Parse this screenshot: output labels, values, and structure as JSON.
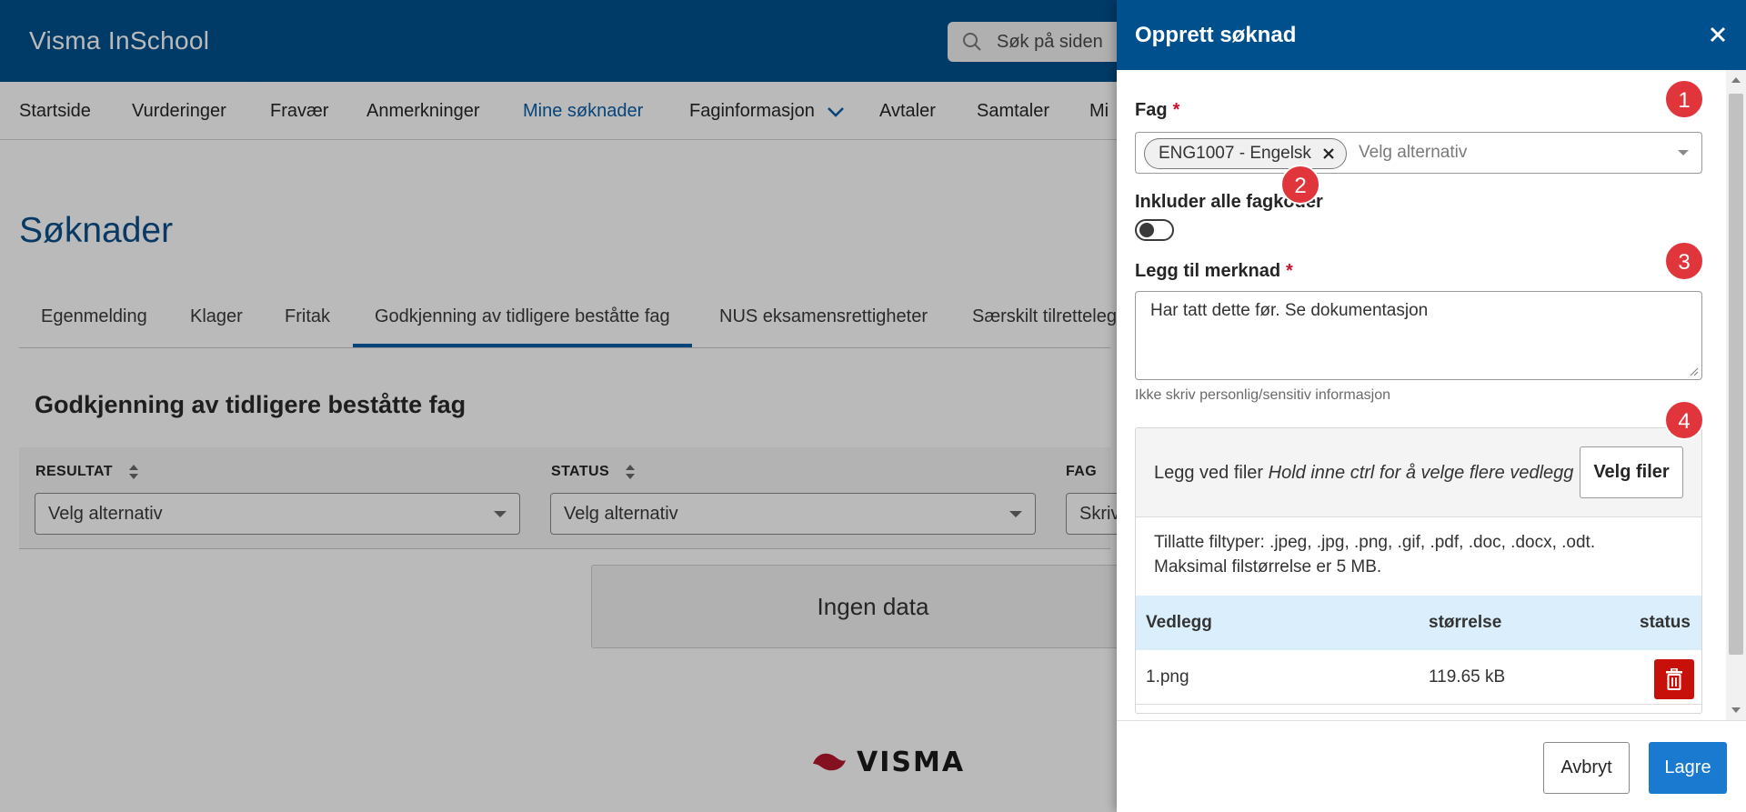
{
  "app": {
    "title": "Visma InSchool",
    "search_placeholder": "Søk på siden",
    "footer_logo_text": "VISMA"
  },
  "nav": {
    "items": [
      {
        "label": "Startside"
      },
      {
        "label": "Vurderinger"
      },
      {
        "label": "Fravær"
      },
      {
        "label": "Anmerkninger"
      },
      {
        "label": "Mine søknader",
        "active": true
      },
      {
        "label": "Faginformasjon",
        "has_dropdown": true
      },
      {
        "label": "Avtaler"
      },
      {
        "label": "Samtaler"
      },
      {
        "label": "Mi"
      }
    ]
  },
  "page": {
    "title": "Søknader",
    "tabs": [
      {
        "label": "Egenmelding"
      },
      {
        "label": "Klager"
      },
      {
        "label": "Fritak"
      },
      {
        "label": "Godkjenning av tidligere beståtte fag",
        "active": true
      },
      {
        "label": "NUS eksamensrettigheter"
      },
      {
        "label": "Særskilt tilretteleg"
      }
    ],
    "section_title": "Godkjenning av tidligere beståtte fag",
    "filters": [
      {
        "label": "RESULTAT",
        "value": "Velg alternativ"
      },
      {
        "label": "STATUS",
        "value": "Velg alternativ"
      },
      {
        "label": "FAG",
        "value": "Skriv"
      }
    ],
    "empty_text": "Ingen data"
  },
  "drawer": {
    "title": "Opprett søknad",
    "close_icon": "close-icon",
    "fag": {
      "label": "Fag",
      "required_mark": "*",
      "selected_chip": "ENG1007 - Engelsk",
      "placeholder": "Velg alternativ"
    },
    "include_all": {
      "label": "Inkluder alle fagkoder",
      "checked": false
    },
    "note": {
      "label": "Legg til merknad",
      "required_mark": "*",
      "value": "Har tatt dette før. Se dokumentasjon",
      "hint": "Ikke skriv personlig/sensitiv informasjon"
    },
    "upload": {
      "label": "Legg ved filer",
      "label_hint": "Hold inne ctrl for å velge flere vedlegg",
      "button": "Velg filer",
      "filetypes_line1": "Tillatte filtyper: .jpeg, .jpg, .png, .gif, .pdf, .doc, .docx, .odt.",
      "filetypes_line2": "Maksimal filstørrelse er 5 MB.",
      "columns": [
        "Vedlegg",
        "størrelse",
        "status"
      ],
      "rows": [
        {
          "name": "1.png",
          "size": "119.65 kB",
          "status_icon": "trash-icon"
        }
      ]
    },
    "badges": [
      "1",
      "2",
      "3",
      "4"
    ],
    "footer": {
      "cancel": "Avbryt",
      "save": "Lagre"
    }
  },
  "colors": {
    "header_blue": "#00508e",
    "link_blue": "#0a5ea8",
    "primary_button": "#1a7ad0",
    "danger": "#c8100a",
    "badge_red": "#e0353b",
    "table_header": "#daeffb"
  }
}
